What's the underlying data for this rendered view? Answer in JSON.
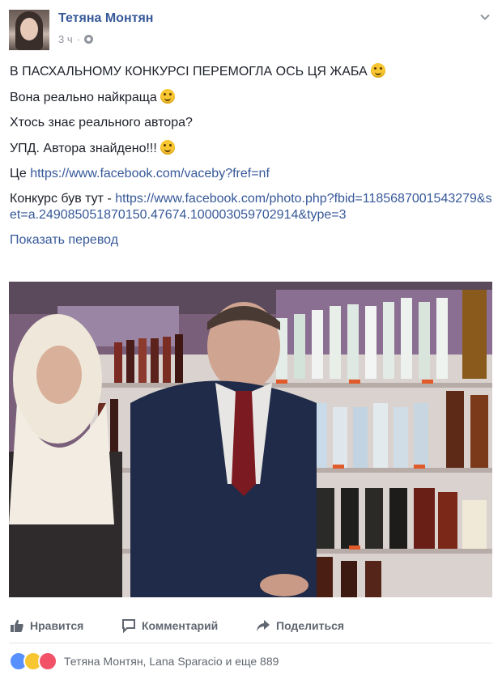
{
  "post": {
    "author": "Тетяна Монтян",
    "time": "3 ч",
    "meta_sep": "·",
    "lines": {
      "l1": "В ПАСХАЛЬНОМУ КОНКУРСІ ПЕРЕМОГЛА ОСЬ ЦЯ ЖАБА",
      "l2": "Вона реально найкраща",
      "l3": "Хтось знає реального автора?",
      "l4": "УПД. Автора знайдено!!!",
      "l5_prefix": "Це",
      "l5_link": "https://www.facebook.com/vaceby?fref=nf",
      "l6_prefix": "Конкурс був тут -",
      "l6_link": "https://www.facebook.com/photo.php?fbid=1185687001543279&set=a.249085051870150.47674.100003059702914&type=3"
    },
    "translate_link": "Показать перевод"
  },
  "actions": {
    "like": "Нравится",
    "comment": "Комментарий",
    "share": "Поделиться"
  },
  "reactions": {
    "summary": "Тетяна Монтян, Lana Sparacio и еще 889",
    "icons": [
      "like-reaction",
      "haha-reaction",
      "love-reaction"
    ]
  },
  "colors": {
    "link": "#365899",
    "muted": "#90949c",
    "action": "#606770"
  }
}
